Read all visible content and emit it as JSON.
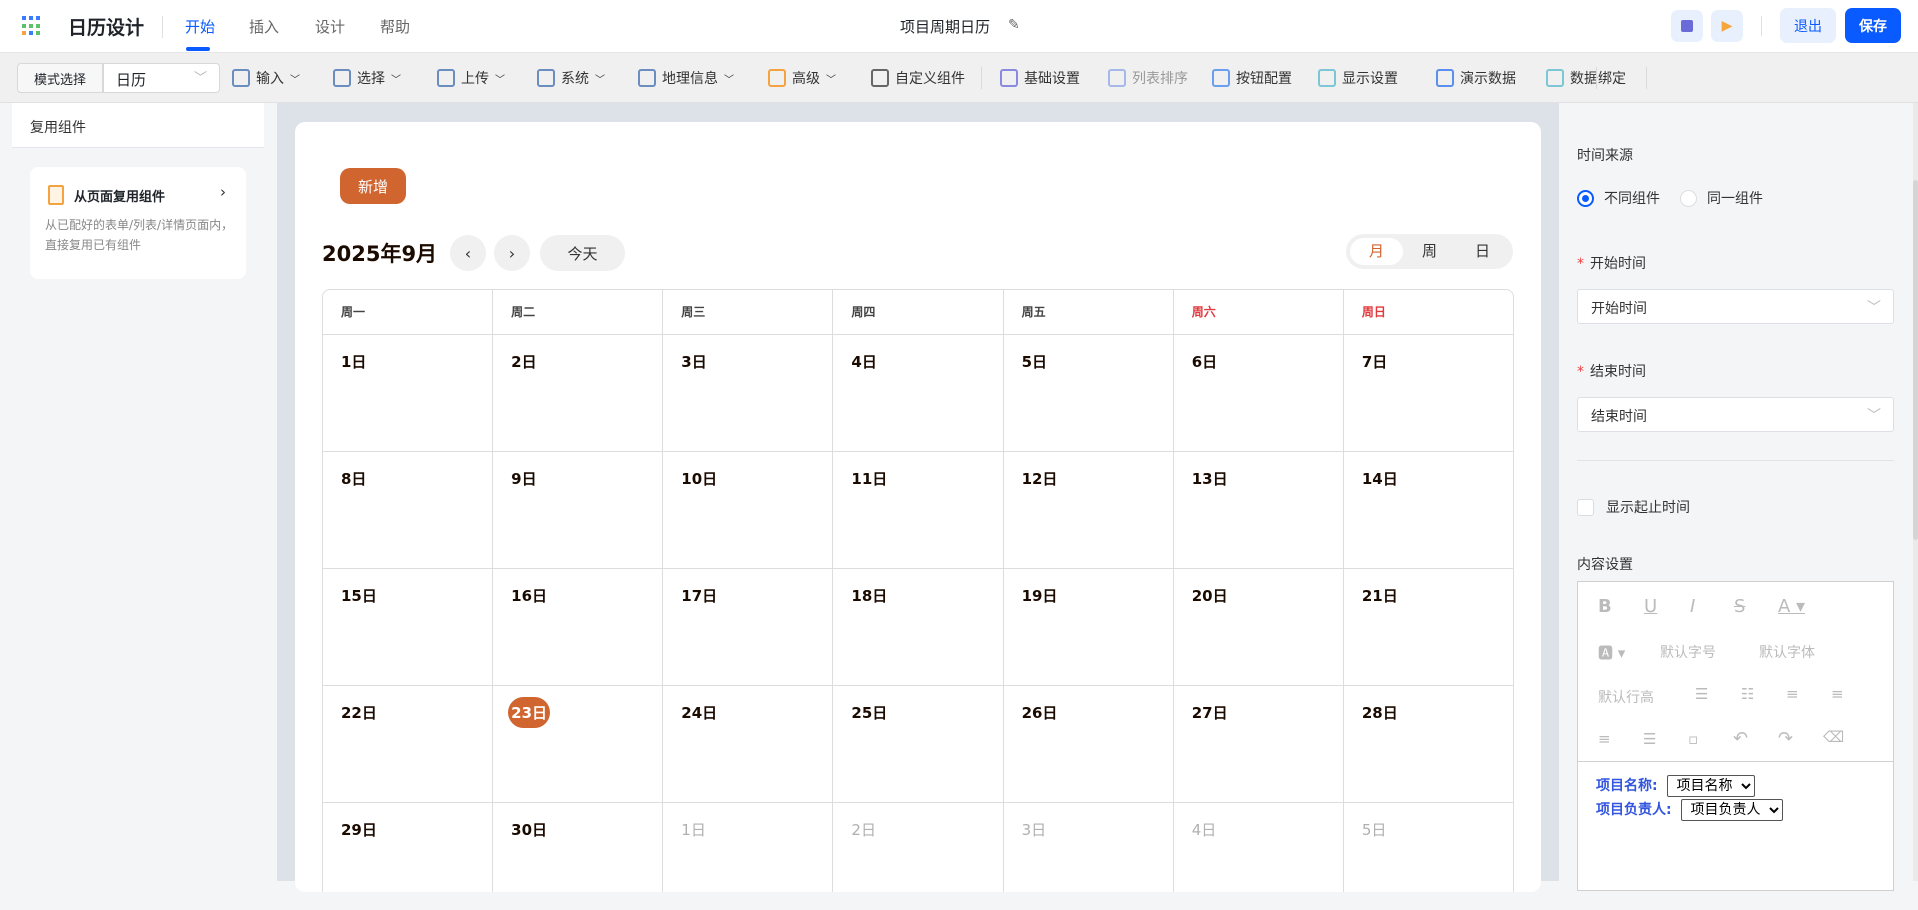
{
  "app": {
    "title": "日历设计",
    "tabs": [
      "开始",
      "插入",
      "设计",
      "帮助"
    ],
    "active_tab": "开始",
    "doc_title": "项目周期日历",
    "exit_label": "退出",
    "save_label": "保存"
  },
  "toolbar": {
    "mode_label": "模式选择",
    "mode_value": "日历",
    "tools": [
      {
        "label": "输入",
        "dd": true
      },
      {
        "label": "选择",
        "dd": true
      },
      {
        "label": "上传",
        "dd": true
      },
      {
        "label": "系统",
        "dd": true
      },
      {
        "label": "地理信息",
        "dd": true
      },
      {
        "label": "高级",
        "dd": true
      },
      {
        "label": "自定义组件"
      },
      {
        "label": "基础设置"
      },
      {
        "label": "列表排序",
        "disabled": true
      },
      {
        "label": "按钮配置"
      },
      {
        "label": "显示设置"
      },
      {
        "label": "演示数据"
      },
      {
        "label": "数据绑定"
      }
    ]
  },
  "left": {
    "title": "复用组件",
    "reuse_title": "从页面复用组件",
    "reuse_desc": "从已配好的表单/列表/详情页面内，直接复用已有组件"
  },
  "calendar": {
    "add_label": "新增",
    "month_title": "2025年9月",
    "today_label": "今天",
    "views": [
      "月",
      "周",
      "日"
    ],
    "active_view": "月",
    "weekdays": [
      "周一",
      "周二",
      "周三",
      "周四",
      "周五",
      "周六",
      "周日"
    ],
    "weeks": [
      [
        "1日",
        "2日",
        "3日",
        "4日",
        "5日",
        "6日",
        "7日"
      ],
      [
        "8日",
        "9日",
        "10日",
        "11日",
        "12日",
        "13日",
        "14日"
      ],
      [
        "15日",
        "16日",
        "17日",
        "18日",
        "19日",
        "20日",
        "21日"
      ],
      [
        "22日",
        "23日",
        "24日",
        "25日",
        "26日",
        "27日",
        "28日"
      ],
      [
        "29日",
        "30日",
        "1日",
        "2日",
        "3日",
        "4日",
        "5日"
      ]
    ],
    "today": "23日",
    "accent": "#d0652f"
  },
  "right": {
    "time_source_label": "时间来源",
    "radio_options": [
      "不同组件",
      "同一组件"
    ],
    "radio_selected": "不同组件",
    "start_label": "开始时间",
    "start_value": "开始时间",
    "end_label": "结束时间",
    "end_value": "结束时间",
    "show_range_label": "显示起止时间",
    "content_label": "内容设置",
    "editor": {
      "font_size": "默认字号",
      "font_family": "默认字体",
      "line_height": "默认行高",
      "fields": [
        {
          "label": "项目名称:",
          "value": "项目名称"
        },
        {
          "label": "项目负责人:",
          "value": "项目负责人"
        }
      ]
    }
  }
}
